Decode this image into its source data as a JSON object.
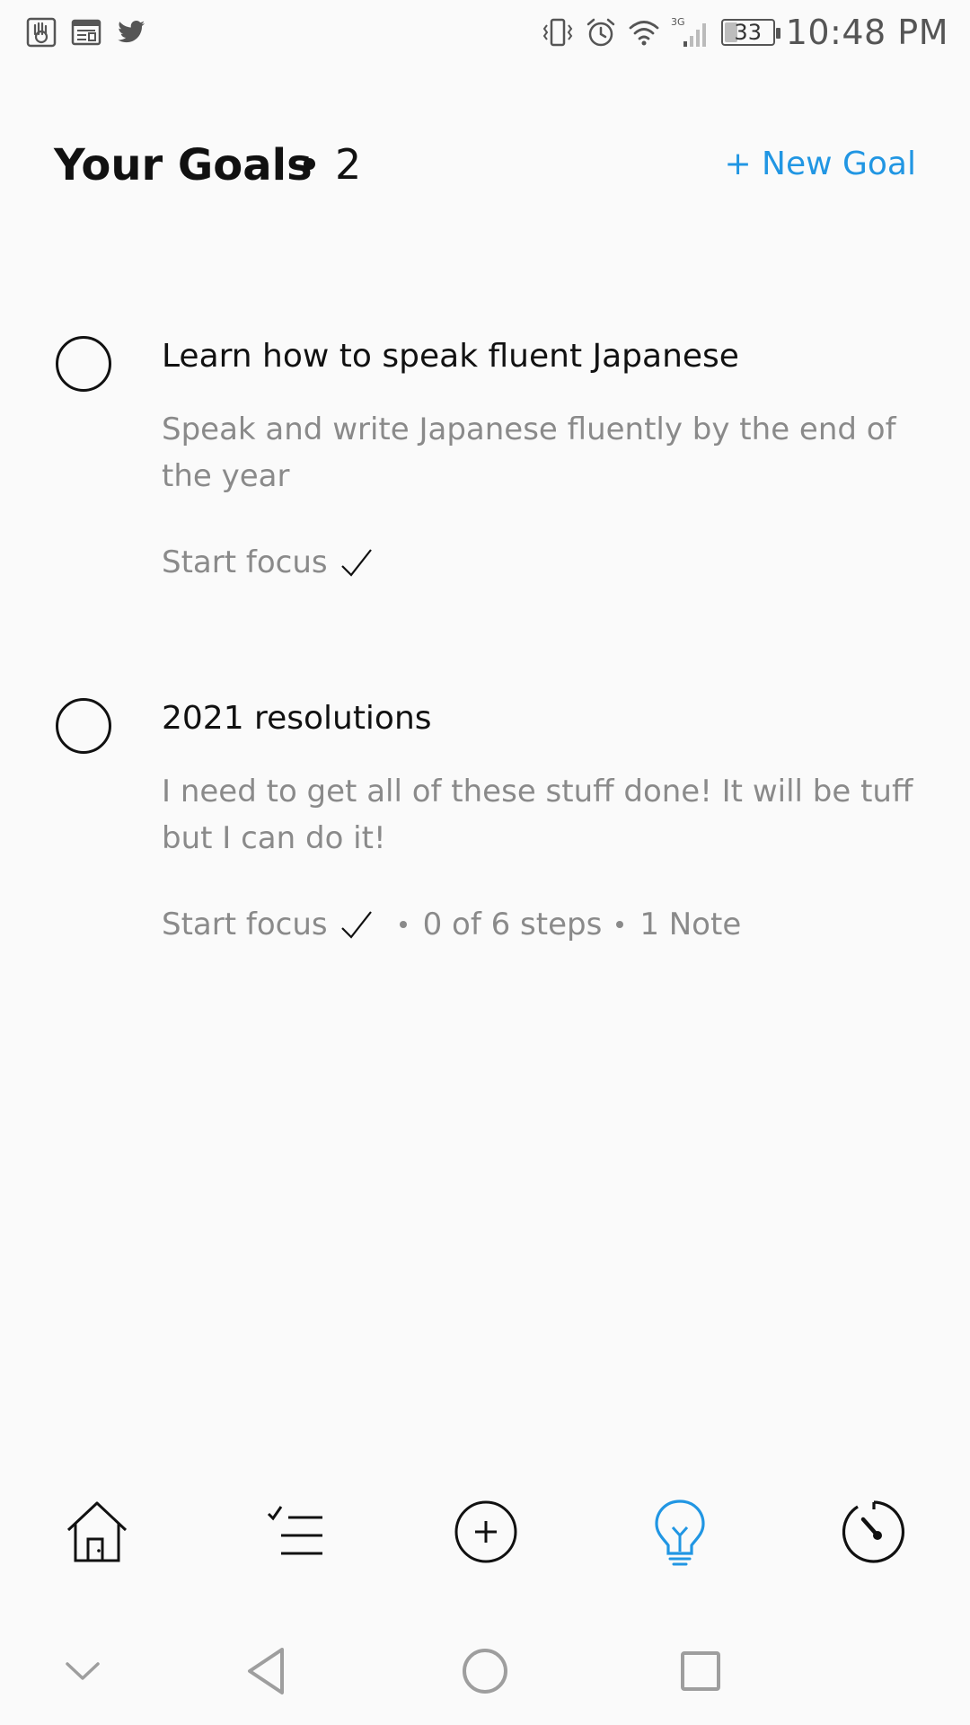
{
  "status_bar": {
    "time": "10:48 PM",
    "battery_level": "33",
    "battery_fraction": 0.33,
    "left_icons": [
      "hand-app-icon",
      "news-app-icon",
      "twitter-icon"
    ],
    "right_icons": [
      "vibrate-icon",
      "alarm-icon",
      "wifi-icon",
      "cellular-3g-icon",
      "battery-icon"
    ],
    "network_label": "3G"
  },
  "header": {
    "title": "Your Goals",
    "count": "2",
    "new_goal_label": "+ New Goal"
  },
  "colors": {
    "accent": "#2196e3",
    "text_primary": "#111111",
    "text_secondary": "#8a8a8a",
    "background": "#fafafa"
  },
  "goals": [
    {
      "title": "Learn how to speak fluent Japanese",
      "description": "Speak and write Japanese fluently by the end of the year",
      "start_focus_label": "Start focus",
      "steps_label": "",
      "notes_label": ""
    },
    {
      "title": "2021 resolutions",
      "description": "I need to get all of these stuff done! It will be tuff but I can do it!",
      "start_focus_label": "Start focus",
      "steps_label": "0 of 6 steps",
      "notes_label": "1 Note"
    }
  ],
  "tab_bar": {
    "tabs": [
      "home-icon",
      "checklist-icon",
      "add-circle-icon",
      "lightbulb-icon",
      "timer-icon"
    ],
    "active_tab": "lightbulb-icon"
  },
  "nav_bar": {
    "buttons": [
      "chevron-down-icon",
      "back-icon",
      "home-circle-icon",
      "recents-icon"
    ]
  }
}
